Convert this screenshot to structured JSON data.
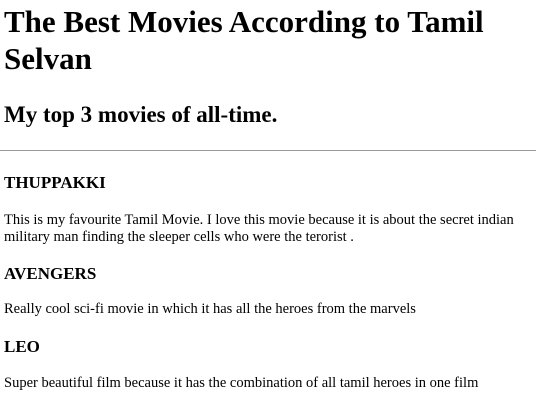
{
  "header": {
    "title": "The Best Movies According to Tamil Selvan",
    "subtitle": "My top 3 movies of all-time."
  },
  "movies": [
    {
      "title": "THUPPAKKI",
      "description": "This is my favourite Tamil Movie. I love this movie because it is about the secret indian military man finding the sleeper cells who were the terorist ."
    },
    {
      "title": "AVENGERS",
      "description": "Really cool sci-fi movie in which it has all the heroes from the marvels"
    },
    {
      "title": "LEO",
      "description": "Super beautiful film because it has the combination of all tamil heroes in one film"
    }
  ]
}
